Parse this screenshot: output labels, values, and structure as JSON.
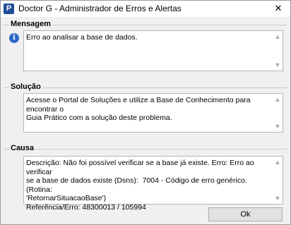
{
  "window": {
    "title": "Doctor G - Administrador de Erros e Alertas",
    "app_icon_letter": "P",
    "close_glyph": "✕"
  },
  "mensagem": {
    "label": "Mensagem",
    "icon": "info-icon",
    "text": "Erro ao analisar a base de dados."
  },
  "solucao": {
    "label": "Solução",
    "text": "Acesse o Portal de Soluções e utilize a Base de Conhecimento para encontrar o\nGuia Prático com a solução deste problema."
  },
  "causa": {
    "label": "Causa",
    "text": "Descrição: Não foi possível verificar se a base já existe. Erro: Erro ao verificar\nse a base de dados existe (Dsns):  7004 - Código de erro genérico.(Rotina:\n'RetornarSituacaoBase')\nReferência/Erro: 48300013 / 105994"
  },
  "ok_button": {
    "label": "Ok"
  },
  "colors": {
    "accent": "#1f4e96",
    "info": "#2f67c9"
  }
}
